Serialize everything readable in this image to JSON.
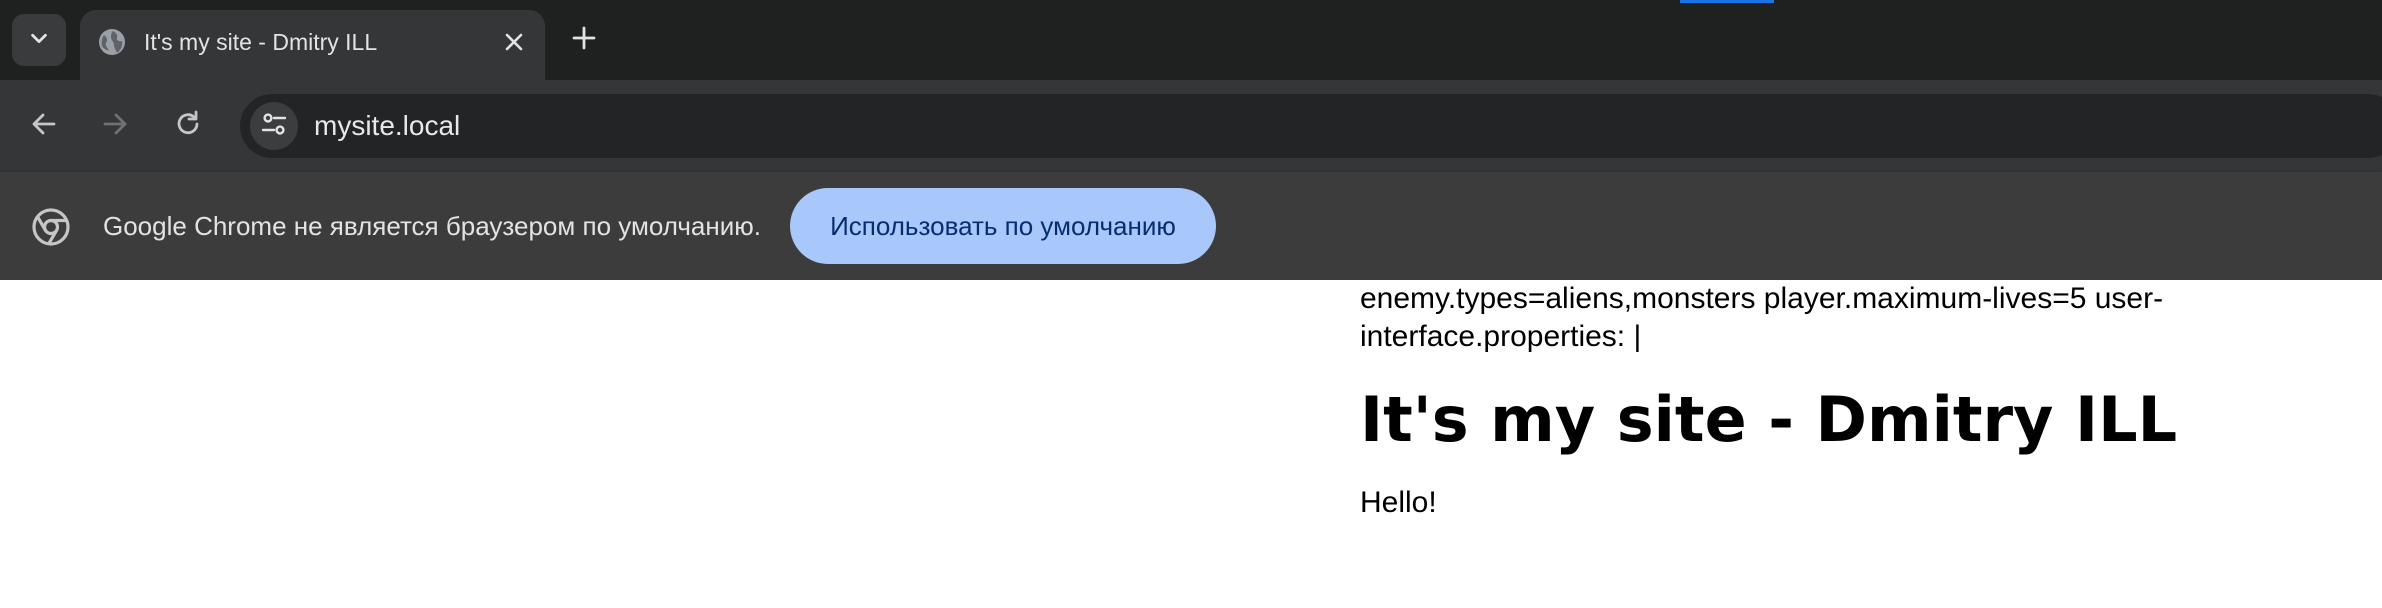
{
  "browser": {
    "tab": {
      "title": "It's my site - Dmitry ILL",
      "favicon": "globe-icon"
    },
    "icons": {
      "tab_search": "chevron-down-icon",
      "close_tab": "close-icon",
      "new_tab": "plus-icon",
      "back": "arrow-left-icon",
      "forward": "arrow-right-icon",
      "reload": "reload-icon",
      "site_info": "tune-icon"
    },
    "address_bar": {
      "url": "mysite.local"
    },
    "infobar": {
      "icon": "chrome-logo-icon",
      "message": "Google Chrome не является браузером по умолчанию.",
      "button_label": "Использовать по умолчанию"
    },
    "colors": {
      "tabstrip_bg": "#1f2020",
      "toolbar_bg": "#353637",
      "omnibox_bg": "#232425",
      "infobar_bg": "#3c3c3c",
      "button_bg": "#a8c7fa",
      "button_text": "#062e6f",
      "accent": "#1a73e8"
    }
  },
  "page": {
    "config_text": "enemy.types=aliens,monsters player.maximum-lives=5 user-interface.properties: |",
    "heading": "It's my site - Dmitry ILL",
    "paragraph": "Hello!"
  }
}
